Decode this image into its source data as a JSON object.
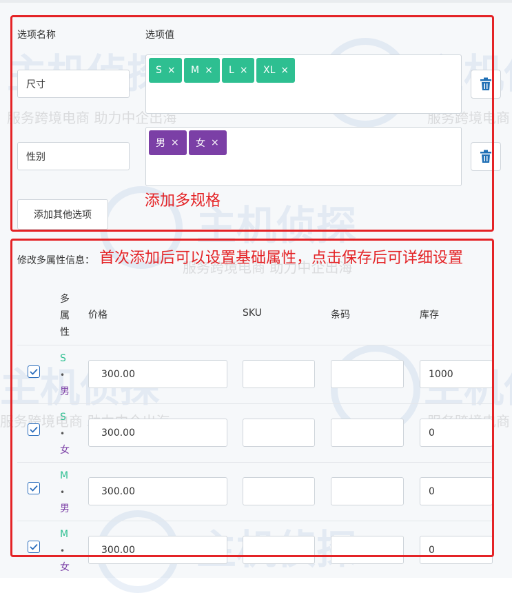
{
  "options": {
    "name_header": "选项名称",
    "value_header": "选项值",
    "rows": [
      {
        "name": "尺寸",
        "tags": [
          "S",
          "M",
          "L",
          "XL"
        ],
        "tag_color": "#2ebf91"
      },
      {
        "name": "性别",
        "tags": [
          "男",
          "女"
        ],
        "tag_color": "#7b3fa6"
      }
    ],
    "tag_remove_glyph": "×",
    "add_button": "添加其他选项"
  },
  "annotations": {
    "add_spec": "添加多规格",
    "first_add": "首次添加后可以设置基础属性，点击保存后可详细设置"
  },
  "variants": {
    "section_label": "修改多属性信息：",
    "columns": {
      "attr": "多属性",
      "price": "价格",
      "sku": "SKU",
      "barcode": "条码",
      "stock": "库存"
    },
    "rows": [
      {
        "checked": true,
        "size": "S",
        "gender": "男",
        "price": "300.00",
        "sku": "",
        "barcode": "",
        "stock": "1000"
      },
      {
        "checked": true,
        "size": "S",
        "gender": "女",
        "price": "300.00",
        "sku": "",
        "barcode": "",
        "stock": "0"
      },
      {
        "checked": true,
        "size": "M",
        "gender": "男",
        "price": "300.00",
        "sku": "",
        "barcode": "",
        "stock": "0"
      },
      {
        "checked": true,
        "size": "M",
        "gender": "女",
        "price": "300.00",
        "sku": "",
        "barcode": "",
        "stock": "0"
      }
    ]
  },
  "watermark": {
    "brand": "主机侦探",
    "slogan": "服务跨境电商 助力中企出海"
  },
  "icons": {
    "trash": "trash-icon",
    "check": "check-icon"
  },
  "colors": {
    "accent_green": "#2ebf91",
    "accent_purple": "#7b3fa6",
    "annotation_red": "#e42326",
    "link_blue": "#2a6dbc"
  }
}
